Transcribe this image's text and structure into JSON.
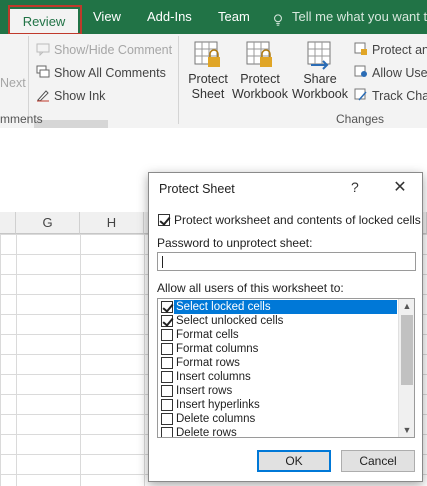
{
  "tabs": {
    "review": "Review",
    "view": "View",
    "addins": "Add-Ins",
    "team": "Team",
    "tellme": "Tell me what you want to"
  },
  "ribbon": {
    "next_label": "Next",
    "show_hide_comment": "Show/Hide Comment",
    "show_all_comments": "Show All Comments",
    "show_ink": "Show Ink",
    "comments_group": "mments",
    "protect_sheet_1": "Protect",
    "protect_sheet_2": "Sheet",
    "protect_workbook_1": "Protect",
    "protect_workbook_2": "Workbook",
    "share_workbook_1": "Share",
    "share_workbook_2": "Workbook",
    "protect_and": "Protect an",
    "allow_users": "Allow User",
    "track_changes": "Track Chan",
    "changes_group": "Changes"
  },
  "columns": [
    "G",
    "H"
  ],
  "dialog": {
    "title": "Protect Sheet",
    "help": "?",
    "close": "✕",
    "protect_checkbox_label": "Protect worksheet and contents of locked cells",
    "protect_checked": true,
    "password_label": "Password to unprotect sheet:",
    "password_value": "",
    "allow_label": "Allow all users of this worksheet to:",
    "options": [
      {
        "label": "Select locked cells",
        "checked": true,
        "selected": true
      },
      {
        "label": "Select unlocked cells",
        "checked": true,
        "selected": false
      },
      {
        "label": "Format cells",
        "checked": false,
        "selected": false
      },
      {
        "label": "Format columns",
        "checked": false,
        "selected": false
      },
      {
        "label": "Format rows",
        "checked": false,
        "selected": false
      },
      {
        "label": "Insert columns",
        "checked": false,
        "selected": false
      },
      {
        "label": "Insert rows",
        "checked": false,
        "selected": false
      },
      {
        "label": "Insert hyperlinks",
        "checked": false,
        "selected": false
      },
      {
        "label": "Delete columns",
        "checked": false,
        "selected": false
      },
      {
        "label": "Delete rows",
        "checked": false,
        "selected": false
      }
    ],
    "ok_label": "OK",
    "cancel_label": "Cancel"
  },
  "colors": {
    "excel_green": "#217346",
    "highlight_red": "#c0392b",
    "selection_blue": "#0078d7"
  }
}
